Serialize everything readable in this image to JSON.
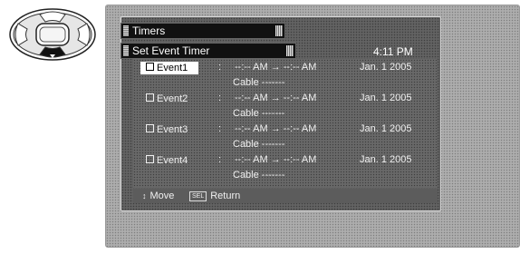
{
  "menu": {
    "title": "Timers",
    "submenu": "Set Event Timer",
    "clock": "4:11 PM"
  },
  "events": [
    {
      "label": "Event1",
      "sep": ":",
      "time": "--:-- AM → --:-- AM",
      "date": "Jan. 1 2005",
      "source": "Cable  -------",
      "selected": true
    },
    {
      "label": "Event2",
      "sep": ":",
      "time": "--:-- AM → --:-- AM",
      "date": "Jan. 1 2005",
      "source": "Cable  -------",
      "selected": false
    },
    {
      "label": "Event3",
      "sep": ":",
      "time": "--:-- AM → --:-- AM",
      "date": "Jan. 1 2005",
      "source": "Cable  -------",
      "selected": false
    },
    {
      "label": "Event4",
      "sep": ":",
      "time": "--:-- AM → --:-- AM",
      "date": "Jan. 1 2005",
      "source": "Cable  -------",
      "selected": false
    }
  ],
  "footer": {
    "move_icon": "up-down-arrows-icon",
    "move_label": "Move",
    "return_key": "SEL",
    "return_label": "Return"
  },
  "remote": {
    "icon": "remote-dpad-icon"
  }
}
